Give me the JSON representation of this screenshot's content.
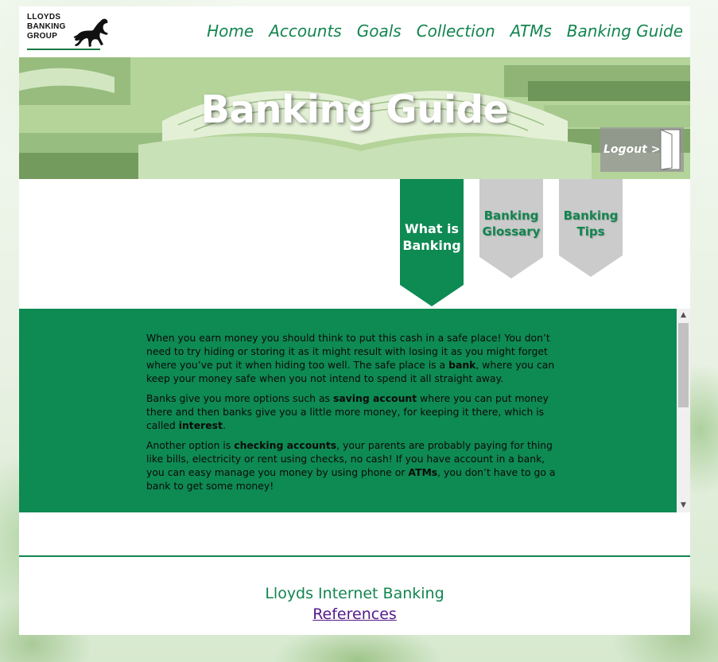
{
  "header": {
    "logo_lines": [
      "LLOYDS",
      "BANKING",
      "GROUP"
    ],
    "nav": [
      {
        "label": "Home"
      },
      {
        "label": "Accounts"
      },
      {
        "label": "Goals"
      },
      {
        "label": "Collection"
      },
      {
        "label": "ATMs"
      },
      {
        "label": "Banking Guide"
      }
    ]
  },
  "banner": {
    "title": "Banking Guide",
    "logout_label": "Logout >>"
  },
  "subtabs": [
    {
      "label_line1": "What is",
      "label_line2": "Banking",
      "active": true
    },
    {
      "label_line1": "Banking",
      "label_line2": "Glossary",
      "active": false
    },
    {
      "label_line1": "Banking",
      "label_line2": "Tips",
      "active": false
    }
  ],
  "content": {
    "paragraphs": [
      [
        {
          "text": "When you earn money you should think to put this cash in a safe place! You don’t need to try hiding or storing it as it might result with losing it as you might forget where you’ve put it when hiding too well. The safe place is a "
        },
        {
          "text": "bank",
          "bold": true
        },
        {
          "text": ", where you can keep your money safe when you not intend to spend it all straight away."
        }
      ],
      [
        {
          "text": "Banks give you more options such as "
        },
        {
          "text": "saving account",
          "bold": true
        },
        {
          "text": " where you can put money there and then banks give you a little more money, for keeping it there, which is called "
        },
        {
          "text": "interest",
          "bold": true
        },
        {
          "text": "."
        }
      ],
      [
        {
          "text": "Another option is "
        },
        {
          "text": "checking accounts",
          "bold": true
        },
        {
          "text": ", your parents are probably paying for thing like bills, electricity or rent using checks, no cash! If you have account in a bank, you can easy manage you money by using phone or "
        },
        {
          "text": "ATMs",
          "bold": true
        },
        {
          "text": ", you don’t have to go a bank to get some money!"
        }
      ]
    ]
  },
  "footer": {
    "title": "Lloyds Internet Banking",
    "link_label": "References"
  },
  "colors": {
    "brand_green": "#138550",
    "content_bg": "#0e8a53",
    "inactive_tab": "#cccccc",
    "link_visited": "#551a8b"
  },
  "icons": {
    "logo": "black-horse-logo-icon",
    "logout": "door-icon",
    "scroll_up": "chevron-up-icon",
    "scroll_down": "chevron-down-icon"
  }
}
